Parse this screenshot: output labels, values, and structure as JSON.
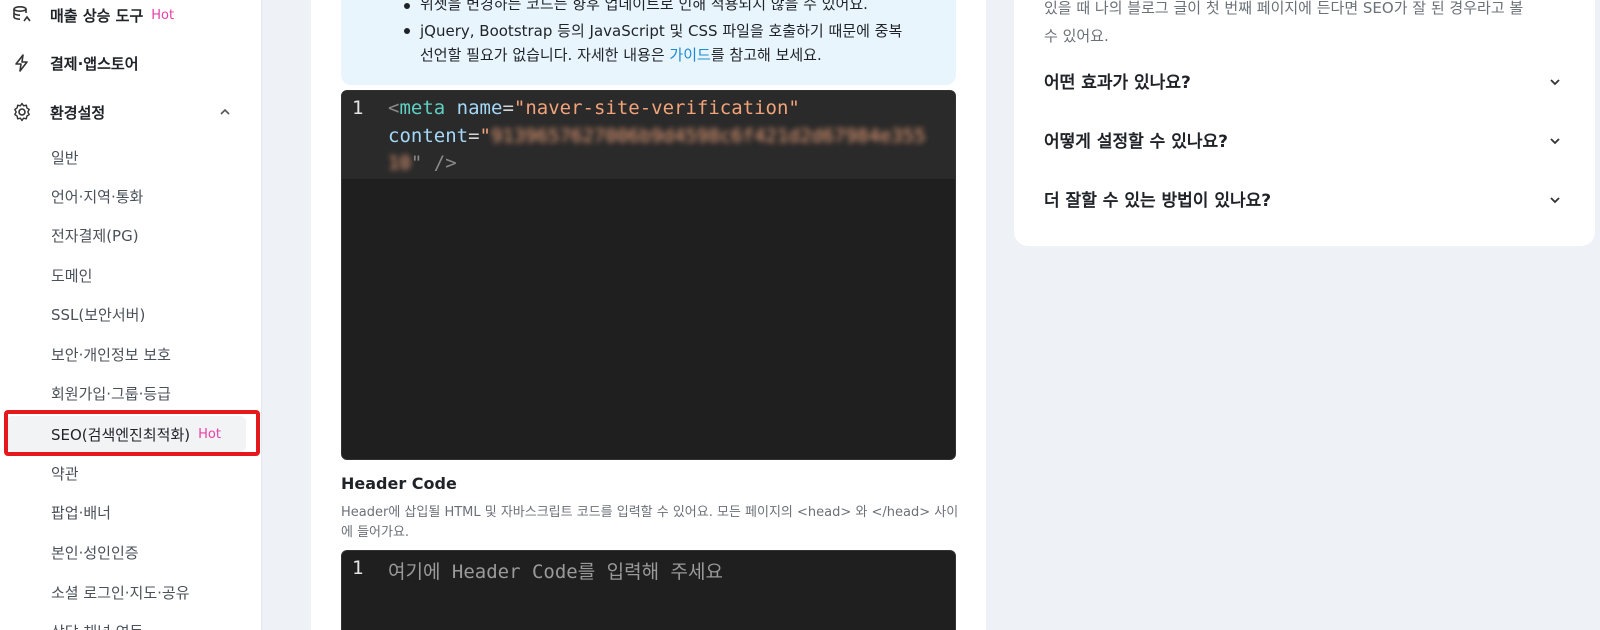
{
  "sidebar": {
    "top_items": [
      {
        "label": "매출 상승 도구",
        "badge": "Hot",
        "icon": "sales-tool-icon"
      },
      {
        "label": "결제·앱스토어",
        "icon": "lightning-icon"
      },
      {
        "label": "환경설정",
        "icon": "gear-icon",
        "expanded": true
      }
    ],
    "sub_items": [
      {
        "label": "일반"
      },
      {
        "label": "언어·지역·통화"
      },
      {
        "label": "전자결제(PG)"
      },
      {
        "label": "도메인"
      },
      {
        "label": "SSL(보안서버)"
      },
      {
        "label": "보안·개인정보 보호"
      },
      {
        "label": "회원가입·그룹·등급"
      },
      {
        "label": "SEO(검색엔진최적화)",
        "badge": "Hot",
        "active": true
      },
      {
        "label": "약관"
      },
      {
        "label": "팝업·배너"
      },
      {
        "label": "본인·성인인증"
      },
      {
        "label": "소셜 로그인·지도·공유"
      },
      {
        "label": "상담 채널 연동"
      }
    ]
  },
  "info": {
    "bullet1": "위젯을 변경하는 코드는 향후 업데이트로 인해 적용되지 않을 수 있어요.",
    "bullet2_line1": "jQuery, Bootstrap 등의 JavaScript 및 CSS 파일을 호출하기 때문에 중복",
    "bullet2_line2_pre": "선언할 필요가 없습니다. 자세한 내용은 ",
    "bullet2_link": "가이드",
    "bullet2_line2_post": "를 참고해 보세요."
  },
  "code_editor": {
    "line_number": "1",
    "open": "<",
    "tag": "meta",
    "attr1": "name",
    "eq": "=",
    "val1": "\"naver-site-verification\"",
    "attr2": "content",
    "quote": "\"",
    "blurred_value_1": "9139657627006b9d4598c6f421d2d67984e355",
    "blurred_value_2": "10",
    "close": "\" />"
  },
  "header_code": {
    "title": "Header Code",
    "description": "Header에 삽입될 HTML 및 자바스크립트 코드를 입력할 수 있어요. 모든 페이지의 <head> 와 </head> 사이에 들어가요.",
    "line_number": "1",
    "placeholder": "여기에 Header Code를 입력해 주세요"
  },
  "faq": {
    "intro_line1": "있을 때 나의 블로그 글이 첫 번째 페이지에 든다면 SEO가 잘 된 경우라고 볼",
    "intro_line2": "수 있어요.",
    "questions": [
      {
        "label": "어떤 효과가 있나요?"
      },
      {
        "label": "어떻게 설정할 수 있나요?"
      },
      {
        "label": "더 잘할 수 있는 방법이 있나요?"
      }
    ]
  },
  "colors": {
    "hot_badge": "#e83fa6",
    "link": "#1a8ad4",
    "highlight": "#e5191d",
    "code_bg": "#1f1f1f"
  }
}
